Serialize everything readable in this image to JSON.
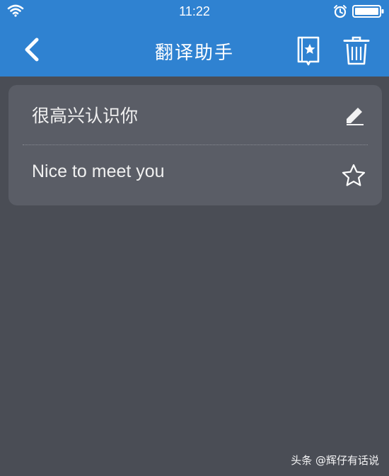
{
  "status_bar": {
    "time": "11:22",
    "icons": [
      "wifi-icon",
      "alarm-icon",
      "battery-icon"
    ]
  },
  "nav": {
    "title": "翻译助手",
    "icons": [
      "back-chevron-icon",
      "bookmark-star-icon",
      "trash-icon"
    ]
  },
  "translation": {
    "source_text": "很高兴认识你",
    "result_text": "Nice to meet you",
    "icons": [
      "pencil-edit-icon",
      "star-outline-icon"
    ]
  },
  "watermark": {
    "text": "头条 @辉仔有话说"
  },
  "colors": {
    "header": "#2f82d1",
    "background": "#4a4d55",
    "card": "#5a5d66",
    "text": "#f0f0f0"
  }
}
